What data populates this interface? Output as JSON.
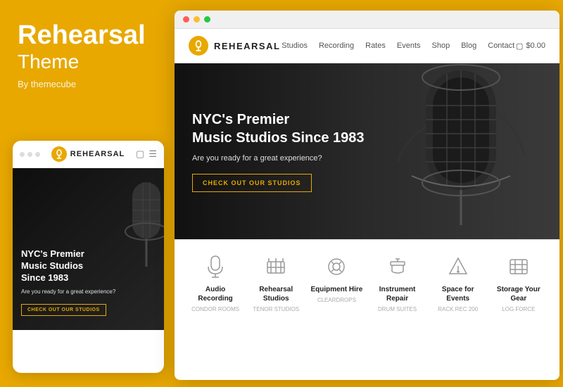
{
  "left": {
    "theme_name": "Rehearsal",
    "theme_word": "Theme",
    "author": "By themecube",
    "mobile_logo": "REHEARSAL",
    "mobile_hero_title": "NYC's Premier\nMusic Studios\nSince 1983",
    "mobile_hero_sub": "Are you ready for a great experience?",
    "mobile_cta": "CHECK OUT OUR STUDIOS"
  },
  "browser": {
    "dots": [
      "red",
      "yellow",
      "green"
    ]
  },
  "site": {
    "logo_text": "REHEARSAL",
    "nav_links": [
      "Studios",
      "Recording",
      "Rates",
      "Events",
      "Shop",
      "Blog",
      "Contact"
    ],
    "cart_label": "$0.00",
    "hero_title_line1": "NYC's Premier",
    "hero_title_line2": "Music Studios Since 1983",
    "hero_sub": "Are you ready for a great experience?",
    "cta_btn": "CHECK OUT OUR STUDIOS",
    "features": [
      {
        "title": "Audio Recording",
        "sub": "CONDOR ROOMS",
        "icon": "mic"
      },
      {
        "title": "Rehearsal Studios",
        "sub": "TENOR STUDIOS",
        "icon": "piano"
      },
      {
        "title": "Equipment Hire",
        "sub": "CLEARDROPS",
        "icon": "headphones"
      },
      {
        "title": "Instrument Repair",
        "sub": "DRUM SUITES",
        "icon": "wrench"
      },
      {
        "title": "Space for Events",
        "sub": "RACK REC 200",
        "icon": "speaker"
      },
      {
        "title": "Storage Your Gear",
        "sub": "LOG FORCE",
        "icon": "box"
      }
    ]
  }
}
